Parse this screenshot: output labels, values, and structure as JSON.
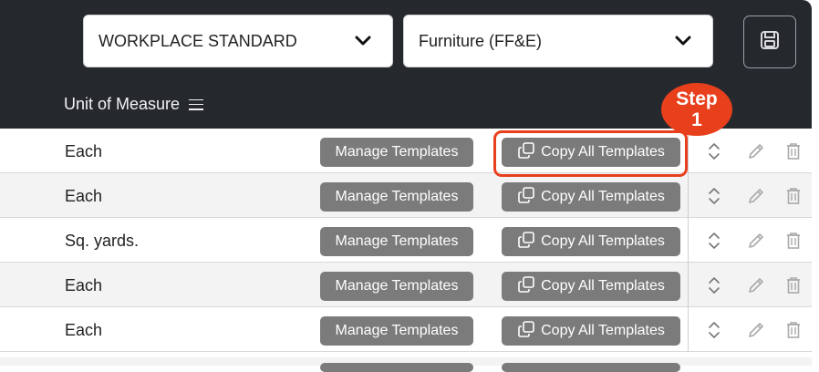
{
  "filters": {
    "standard": {
      "value": "WORKPLACE STANDARD"
    },
    "category": {
      "value": "Furniture (FF&E)"
    }
  },
  "icons": {
    "save": "floppy-disk-icon",
    "column_menu": "hamburger-menu-icon",
    "copy": "copy-icon",
    "reorder": "sort-updown-icon",
    "edit": "pencil-icon",
    "delete": "trash-icon"
  },
  "table": {
    "column_header": "Unit of Measure",
    "rows": [
      {
        "unit": "Each",
        "manage_label": "Manage Templates",
        "copy_label": "Copy All Templates"
      },
      {
        "unit": "Each",
        "manage_label": "Manage Templates",
        "copy_label": "Copy All Templates"
      },
      {
        "unit": "Sq. yards.",
        "manage_label": "Manage Templates",
        "copy_label": "Copy All Templates"
      },
      {
        "unit": "Each",
        "manage_label": "Manage Templates",
        "copy_label": "Copy All Templates"
      },
      {
        "unit": "Each",
        "manage_label": "Manage Templates",
        "copy_label": "Copy All Templates"
      }
    ]
  },
  "annotation": {
    "step_label": "Step",
    "step_number": "1",
    "color": "#e8401c"
  },
  "colors": {
    "header_bg": "#25292e",
    "button_bg": "#7b7b7b",
    "row_alt_bg": "#f3f3f3"
  }
}
